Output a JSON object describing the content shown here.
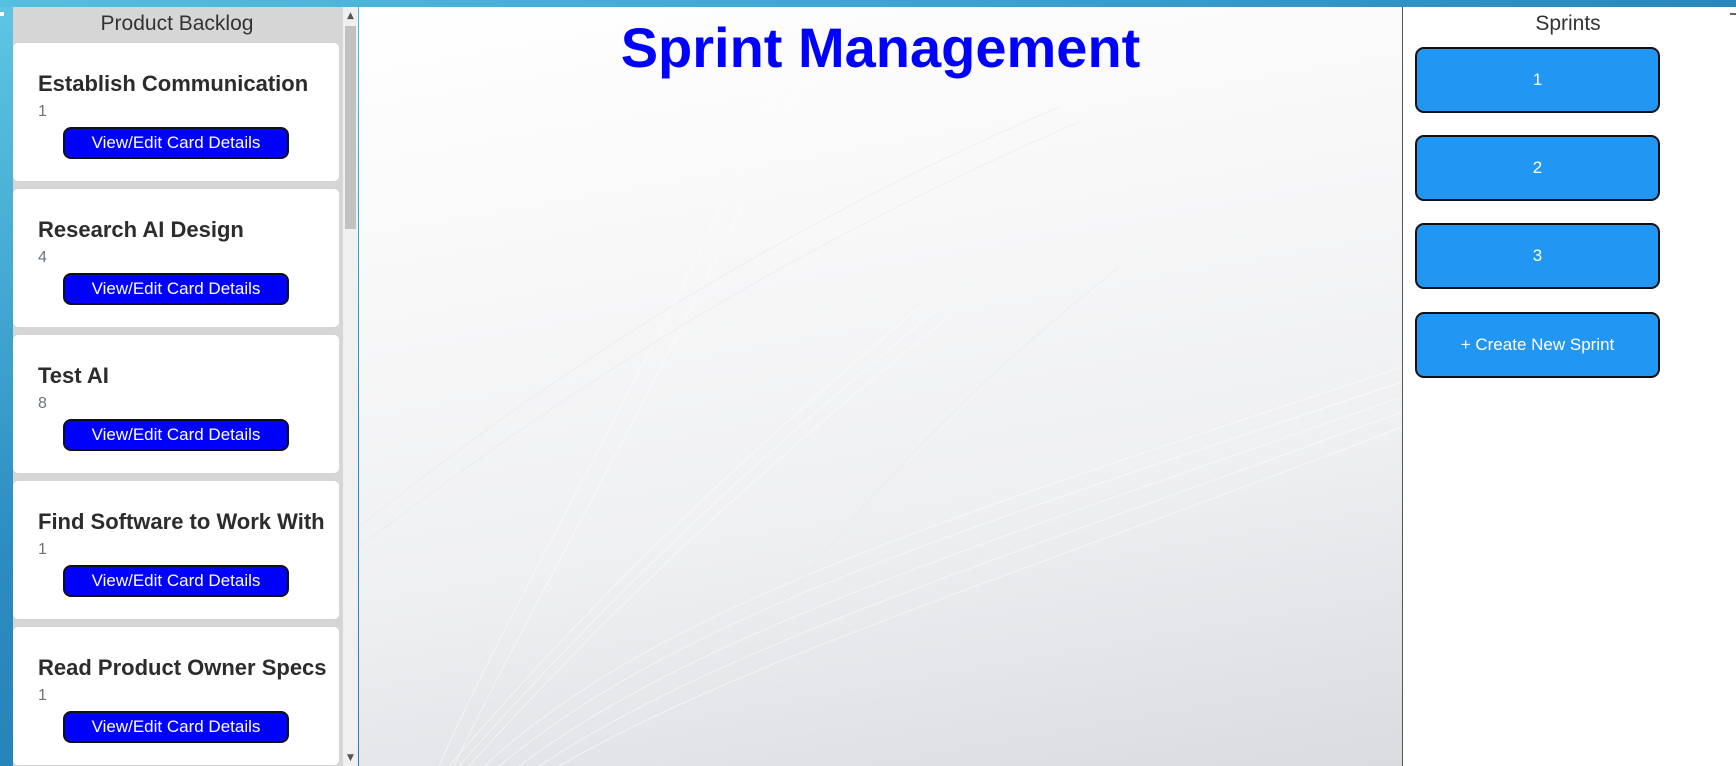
{
  "backlog": {
    "header": "Product Backlog",
    "cards": [
      {
        "title": "Establish Communication",
        "points": "1",
        "button": "View/Edit Card Details"
      },
      {
        "title": "Research AI Design",
        "points": "4",
        "button": "View/Edit Card Details"
      },
      {
        "title": "Test AI",
        "points": "8",
        "button": "View/Edit Card Details"
      },
      {
        "title": "Find Software to Work With",
        "points": "1",
        "button": "View/Edit Card Details"
      },
      {
        "title": "Read Product Owner Specs",
        "points": "1",
        "button": "View/Edit Card Details"
      }
    ]
  },
  "main": {
    "title": "Sprint Management"
  },
  "sprints": {
    "header": "Sprints",
    "items": [
      {
        "label": "1"
      },
      {
        "label": "2"
      },
      {
        "label": "3"
      }
    ],
    "create_label": "+ Create New Sprint"
  },
  "colors": {
    "title_blue": "#0000ff",
    "card_button_blue": "#0000ff",
    "sprint_button_blue": "#2196f3",
    "desktop_teal": "#2b8cc0"
  },
  "icons": {
    "scroll_up": "triangle-up-icon",
    "scroll_down": "triangle-down-icon"
  }
}
